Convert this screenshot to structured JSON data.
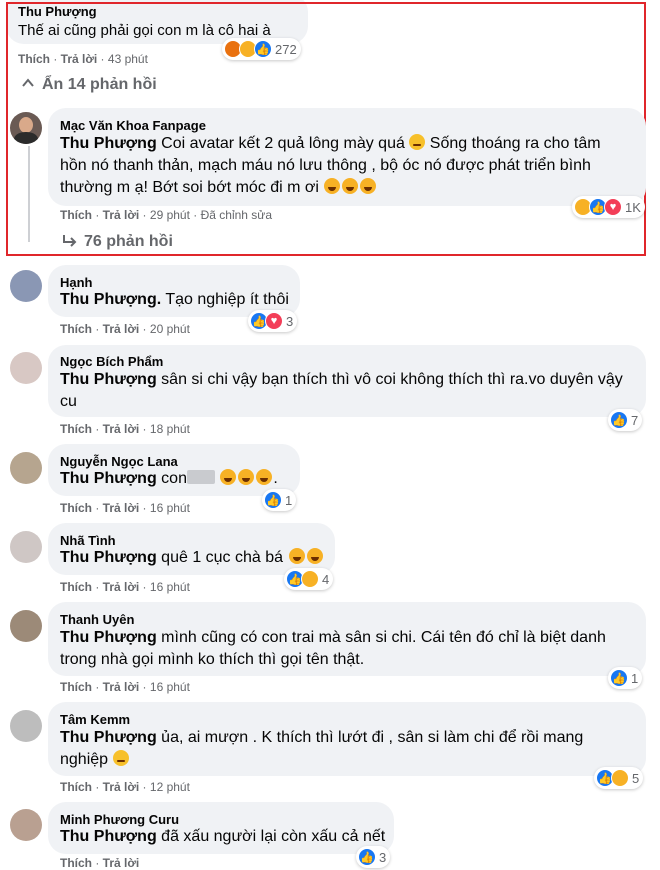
{
  "top_comment": {
    "author": "Thu Phượng",
    "text": "Thế ai cũng phải gọi con m là cô hai à",
    "like_label": "Thích",
    "reply_label": "Trả lời",
    "time": "43 phút",
    "reaction_count": "272",
    "hide_replies": "Ẩn 14 phản hồi"
  },
  "highlight_reply": {
    "author": "Mạc Văn Khoa Fanpage",
    "mention": "Thu Phượng",
    "line1": "Coi avatar kết 2 quả lông mày quá",
    "line1_after": "Sống thoáng ra cho tâm",
    "line2": "hồn nó thanh thản, mạch máu nó lưu thông , bộ óc nó được phát triển bình",
    "line3": "thường m ạ! Bớt soi bớt móc đi m ơi",
    "like_label": "Thích",
    "reply_label": "Trả lời",
    "time": "29 phút",
    "edited": "Đã chỉnh sửa",
    "reaction_count": "1K",
    "more_replies": "76 phản hồi"
  },
  "replies": [
    {
      "author": "Hạnh",
      "mention": "Thu Phượng.",
      "text": "Tạo nghiệp ít thôi",
      "like_label": "Thích",
      "reply_label": "Trả lời",
      "time": "20 phút",
      "reaction_count": "3"
    },
    {
      "author": "Ngọc Bích Phẩm",
      "mention": "Thu Phượng",
      "text": "sân si chi vậy bạn thích thì vô coi không thích thì ra.vo duyên vậy",
      "text2": "cu",
      "like_label": "Thích",
      "reply_label": "Trả lời",
      "time": "18 phút",
      "reaction_count": "7"
    },
    {
      "author": "Nguyễn Ngọc Lana",
      "mention": "Thu Phượng",
      "text": "con",
      "text_end": ".",
      "like_label": "Thích",
      "reply_label": "Trả lời",
      "time": "16 phút",
      "reaction_count": "1"
    },
    {
      "author": "Nhã Tình",
      "mention": "Thu Phượng",
      "text": "quê 1 cục chà bá",
      "like_label": "Thích",
      "reply_label": "Trả lời",
      "time": "16 phút",
      "reaction_count": "4"
    },
    {
      "author": "Thanh Uyên",
      "mention": "Thu Phượng",
      "text": "mình cũng có con trai mà sân si chi. Cái tên đó chỉ là biệt danh",
      "text2": "trong nhà gọi mình ko thích thì gọi tên thật.",
      "like_label": "Thích",
      "reply_label": "Trả lời",
      "time": "16 phút",
      "reaction_count": "1"
    },
    {
      "author": "Tâm Kemm",
      "mention": "Thu Phượng",
      "text": "ủa, ai mượn . K thích thì lướt đi , sân si làm chi để rồi mang",
      "text2": "nghiệp",
      "like_label": "Thích",
      "reply_label": "Trả lời",
      "time": "12 phút",
      "reaction_count": "5"
    },
    {
      "author": "Minh Phương Curu",
      "mention": "Thu Phượng",
      "text": "đã xấu người lại còn xấu cả nết",
      "like_label": "Thích",
      "reply_label": "Trả lời",
      "reaction_count": "3"
    }
  ],
  "colors": {
    "highlight_border": "#e0262b",
    "bubble": "#f0f2f5",
    "secondary_text": "#65676b",
    "like_blue": "#1877f2"
  }
}
